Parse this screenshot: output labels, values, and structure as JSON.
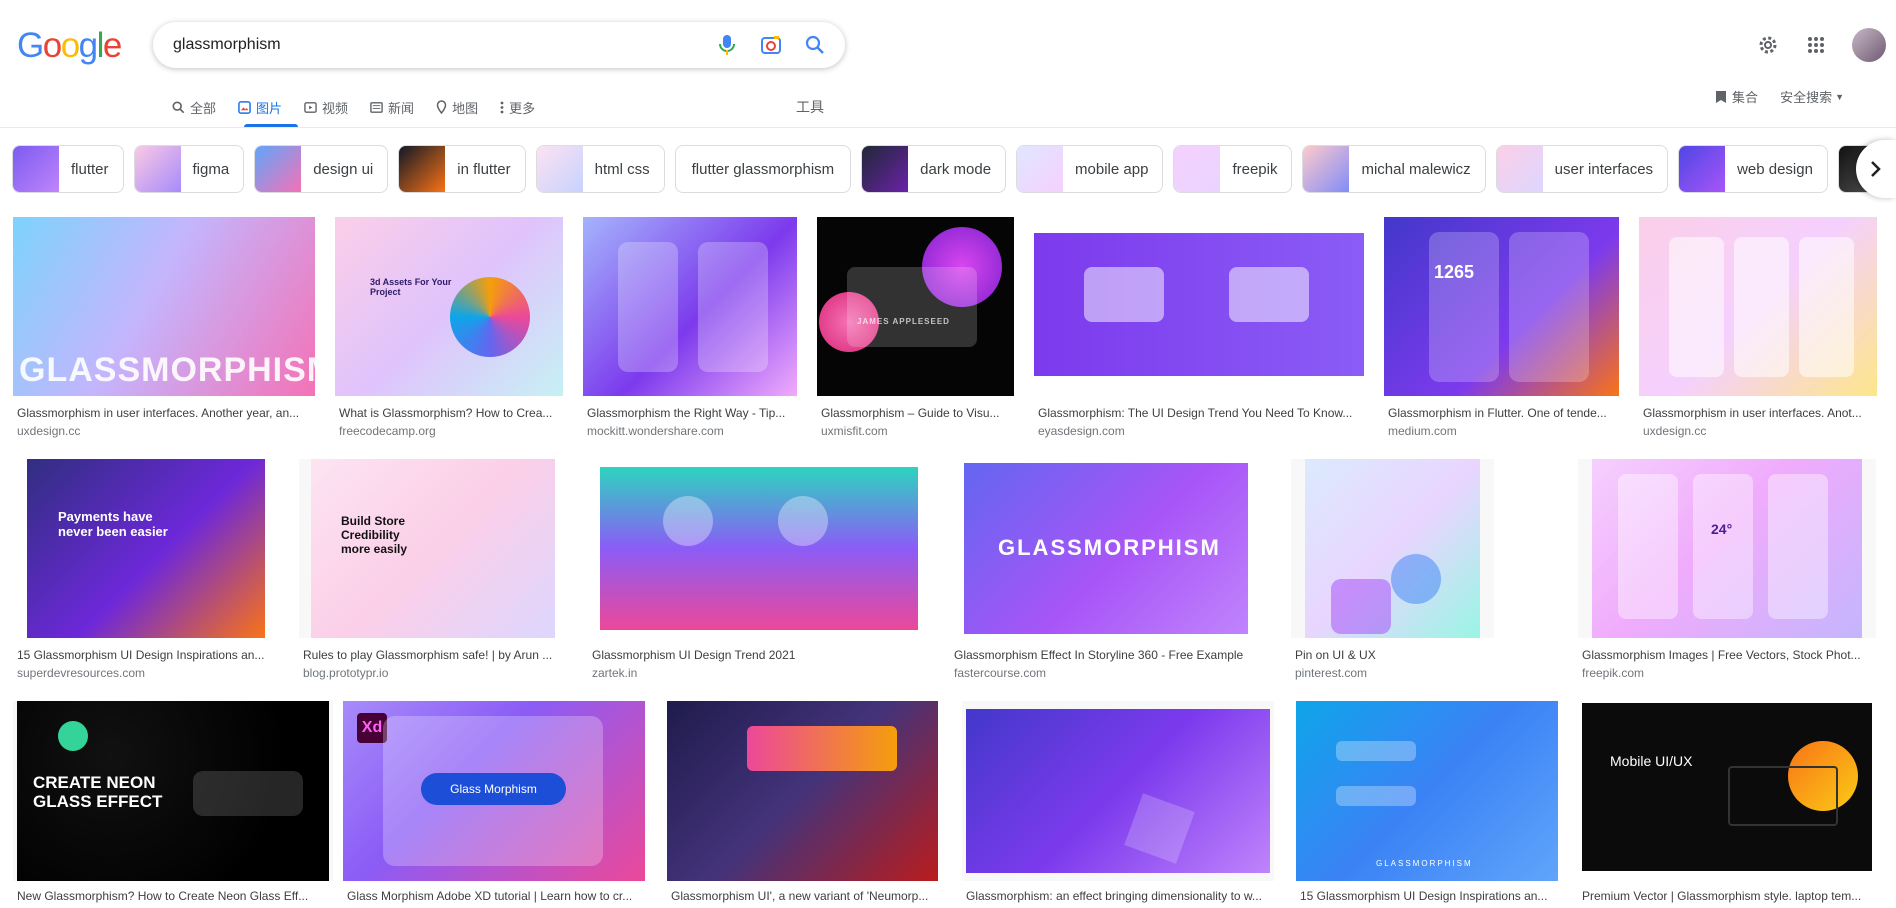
{
  "logo": "Google",
  "search": {
    "query": "glassmorphism"
  },
  "tabs": [
    {
      "label": "全部",
      "icon": "search-icon"
    },
    {
      "label": "图片",
      "icon": "image-icon"
    },
    {
      "label": "视频",
      "icon": "video-icon"
    },
    {
      "label": "新闻",
      "icon": "news-icon"
    },
    {
      "label": "地图",
      "icon": "map-pin-icon"
    },
    {
      "label": "更多",
      "icon": "more-vert-icon"
    }
  ],
  "tools_label": "工具",
  "collections_label": "集合",
  "safesearch_label": "安全搜索",
  "chips": [
    {
      "label": "flutter"
    },
    {
      "label": "figma"
    },
    {
      "label": "design ui"
    },
    {
      "label": "in flutter"
    },
    {
      "label": "html css"
    },
    {
      "label": "flutter glassmorphism"
    },
    {
      "label": "dark mode"
    },
    {
      "label": "mobile app"
    },
    {
      "label": "freepik"
    },
    {
      "label": "michal malewicz"
    },
    {
      "label": "user interfaces"
    },
    {
      "label": "web design"
    }
  ],
  "results": [
    {
      "title": "Glassmorphism in user interfaces. Another year, an...",
      "source": "uxdesign.cc",
      "overlay": "GLASSMORPHISM"
    },
    {
      "title": "What is Glassmorphism? How to Crea...",
      "source": "freecodecamp.org",
      "overlay": "3d Assets For Your Project"
    },
    {
      "title": "Glassmorphism the Right Way - Tip...",
      "source": "mockitt.wondershare.com",
      "overlay": ""
    },
    {
      "title": "Glassmorphism – Guide to Visu...",
      "source": "uxmisfit.com",
      "overlay": "JAMES APPLESEED"
    },
    {
      "title": "Glassmorphism: The UI Design Trend You Need To Know...",
      "source": "eyasdesign.com",
      "overlay": ""
    },
    {
      "title": "Glassmorphism in Flutter. One of tende...",
      "source": "medium.com",
      "overlay": "1265"
    },
    {
      "title": "Glassmorphism in user interfaces. Anot...",
      "source": "uxdesign.cc",
      "overlay": ""
    },
    {
      "title": "15 Glassmorphism UI Design Inspirations an...",
      "source": "superdevresources.com",
      "overlay": "Payments have never been easier"
    },
    {
      "title": "Rules to play Glassmorphism safe! | by Arun ...",
      "source": "blog.prototypr.io",
      "overlay": "Build Store Credibility more easily"
    },
    {
      "title": "Glassmorphism UI Design Trend 2021",
      "source": "zartek.in",
      "overlay": ""
    },
    {
      "title": "Glassmorphism Effect In Storyline 360 - Free Example",
      "source": "fastercourse.com",
      "overlay": "GLASSMORPHISM"
    },
    {
      "title": "Pin on UI & UX",
      "source": "pinterest.com",
      "overlay": ""
    },
    {
      "title": "Glassmorphism Images | Free Vectors, Stock Phot...",
      "source": "freepik.com",
      "overlay": "24°"
    },
    {
      "title": "New Glassmorphism? How to Create Neon Glass Eff...",
      "source": "",
      "overlay": "CREATE NEON GLASS EFFECT"
    },
    {
      "title": "Glass Morphism Adobe XD tutorial | Learn how to cr...",
      "source": "",
      "overlay": "Glass Morphism"
    },
    {
      "title": "Glassmorphism UI', a new variant of 'Neumorp...",
      "source": "",
      "overlay": ""
    },
    {
      "title": "Glassmorphism: an effect bringing dimensionality to w...",
      "source": "",
      "overlay": ""
    },
    {
      "title": "15 Glassmorphism UI Design Inspirations an...",
      "source": "",
      "overlay": "GLASSMORPHISM"
    },
    {
      "title": "Premium Vector | Glassmorphism style. laptop tem...",
      "source": "",
      "overlay": "Mobile UI/UX"
    }
  ]
}
